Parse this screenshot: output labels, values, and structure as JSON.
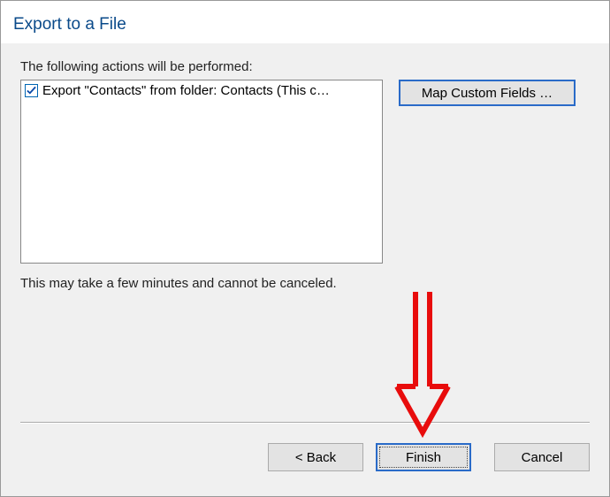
{
  "dialog": {
    "title": "Export to a File",
    "instruction": "The following actions will be performed:",
    "note": "This may take a few minutes and cannot be canceled."
  },
  "actions": [
    {
      "checked": true,
      "label": "Export \"Contacts\" from folder: Contacts (This c…"
    }
  ],
  "buttons": {
    "map": "Map Custom Fields …",
    "back": "< Back",
    "finish": "Finish",
    "cancel": "Cancel"
  },
  "annotation": {
    "color": "#e80c0c"
  }
}
